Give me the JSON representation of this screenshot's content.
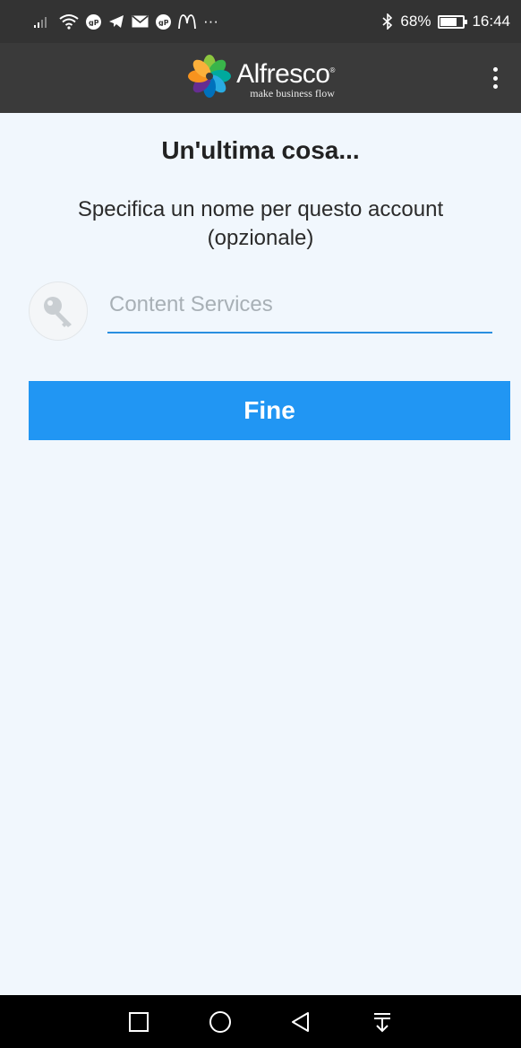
{
  "status_bar": {
    "battery": "68%",
    "battery_level": 0.68,
    "time": "16:44",
    "overflow_indicator": "···",
    "left_icons": [
      "signal-icon",
      "wifi-icon",
      "app-badge-icon",
      "telegram-icon",
      "mail-icon",
      "app-badge-icon",
      "mcdonalds-icon"
    ],
    "right_icons": [
      "bluetooth-icon",
      "battery-icon"
    ]
  },
  "app_bar": {
    "logo_name": "Alfresco",
    "logo_mark": "®",
    "logo_tagline": "make business flow",
    "menu_icon": "more-vertical-icon"
  },
  "content": {
    "title": "Un'ultima cosa...",
    "subtitle": "Specifica un nome per questo account (opzionale)",
    "account_name_placeholder": "Content Services",
    "account_name_value": "",
    "finish_label": "Fine",
    "field_icon": "key-icon"
  },
  "nav_bar": {
    "buttons": [
      "recent-apps-icon",
      "home-icon",
      "back-icon",
      "notifications-pull-icon"
    ]
  },
  "colors": {
    "status_bar_bg": "#333333",
    "app_bar_bg": "#3a3a3a",
    "page_bg": "#f1f7fd",
    "accent": "#2196f3",
    "nav_bar_bg": "#000000"
  }
}
